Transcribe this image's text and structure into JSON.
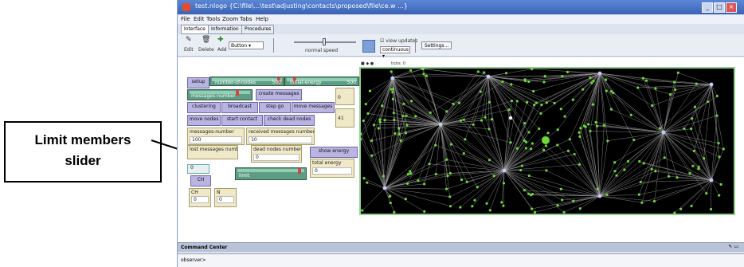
{
  "annotation": {
    "line1": "Limit members",
    "line2": "slider"
  },
  "window": {
    "title": "test.nlogo {C:\\file\\...\\test\\adjusting\\contacts\\proposed\\file\\ce.w ...}",
    "menu": [
      "File",
      "Edit",
      "Tools",
      "Zoom",
      "Tabs",
      "Help"
    ],
    "tabs": [
      "Interface",
      "Information",
      "Procedures"
    ],
    "min": "_",
    "max": "□",
    "close": "×"
  },
  "toolbar": {
    "edit": "Edit",
    "delete": "Delete",
    "add": "Add",
    "widget_select": "Button",
    "speed_label": "normal speed",
    "view_updates": "view updates",
    "update_mode": "continuous",
    "settings": "Settings..."
  },
  "widgets": {
    "setup": "setup",
    "slider1": "number-of-nodes",
    "slider1_value": "500",
    "slider2": "initial-energy",
    "slider2_value": "500",
    "messages_number_slider": "messages-number",
    "create_messages": "create messages",
    "clustering": "clustering",
    "broadcast": "broadcast",
    "step_go": "step go",
    "move_messages": "move messages",
    "move_nodes": "move nodes",
    "start_contact": "start contact",
    "check_dead_nodes": "check dead nodes",
    "messages_number_mon": "messages-number",
    "messages_number_val": "100",
    "received_messages_mon": "received messages number",
    "received_messages_val": "10",
    "lost_messages_mon": "lost messages number",
    "dead_nodes_mon": "dead nodes number",
    "dead_nodes_val": "0",
    "show_energy": "show energy",
    "total_energy_mon": "total energy",
    "total_energy_val": "0",
    "limit_slider": "limit",
    "cluster_btn": "CH",
    "m1_label": "CH",
    "m1_val": "0",
    "m2_label": "N",
    "m2_val": "0",
    "side_mon_val": "0",
    "side_mon2_val": "41",
    "mini_mon_val": "0"
  },
  "view": {
    "ticks": "ticks: 0"
  },
  "command_center": {
    "label": "Command Center",
    "observer": "observer>"
  },
  "colors": {
    "turtle": "#6ed83c",
    "view_bg": "#000000",
    "link": "#9c9c9c",
    "button": "#b9b4e2",
    "monitor": "#efe9c8",
    "slider": "#5f9c84"
  }
}
